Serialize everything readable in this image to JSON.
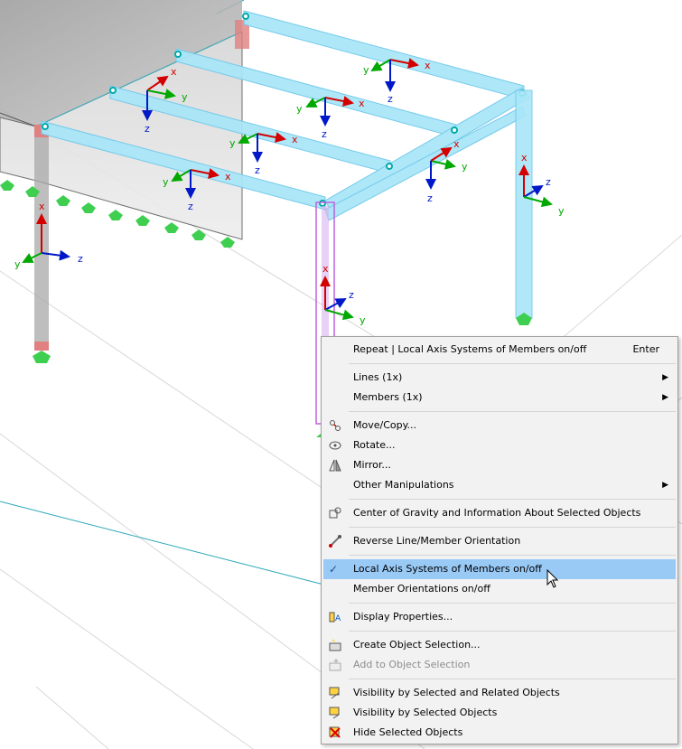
{
  "axes": {
    "x": "x",
    "y": "y",
    "z": "z"
  },
  "colors": {
    "member": "#a9e6f8",
    "member_edge": "#6fc8ea",
    "slab": "#b4b4b4",
    "support": "#3fcf50",
    "axis_x": "#d40000",
    "axis_y": "#00a800",
    "axis_z": "#0018c8",
    "selection": "#c060e0",
    "menu_highlight": "#99c9f5"
  },
  "context_menu": {
    "items": [
      {
        "label": "Repeat | Local Axis Systems of Members on/off",
        "shortcut": "Enter"
      },
      {
        "label": "Lines (1x)",
        "submenu": true
      },
      {
        "label": "Members (1x)",
        "submenu": true
      },
      {
        "label": "Move/Copy...",
        "icon": "move-copy-icon"
      },
      {
        "label": "Rotate...",
        "icon": "rotate-icon"
      },
      {
        "label": "Mirror...",
        "icon": "mirror-icon"
      },
      {
        "label": "Other Manipulations",
        "submenu": true
      },
      {
        "label": "Center of Gravity and Information About Selected Objects",
        "icon": "center-of-gravity-icon"
      },
      {
        "label": "Reverse Line/Member Orientation",
        "icon": "reverse-orientation-icon"
      },
      {
        "label": "Local Axis Systems of Members on/off",
        "checked": true,
        "highlighted": true
      },
      {
        "label": "Member Orientations on/off"
      },
      {
        "label": "Display Properties...",
        "icon": "display-properties-icon"
      },
      {
        "label": "Create Object Selection...",
        "icon": "create-selection-icon"
      },
      {
        "label": "Add to Object Selection",
        "icon": "add-selection-icon",
        "disabled": true
      },
      {
        "label": "Visibility by Selected and Related Objects",
        "icon": "visibility-related-icon"
      },
      {
        "label": "Visibility by Selected Objects",
        "icon": "visibility-selected-icon"
      },
      {
        "label": "Hide Selected Objects",
        "icon": "hide-objects-icon"
      }
    ]
  }
}
